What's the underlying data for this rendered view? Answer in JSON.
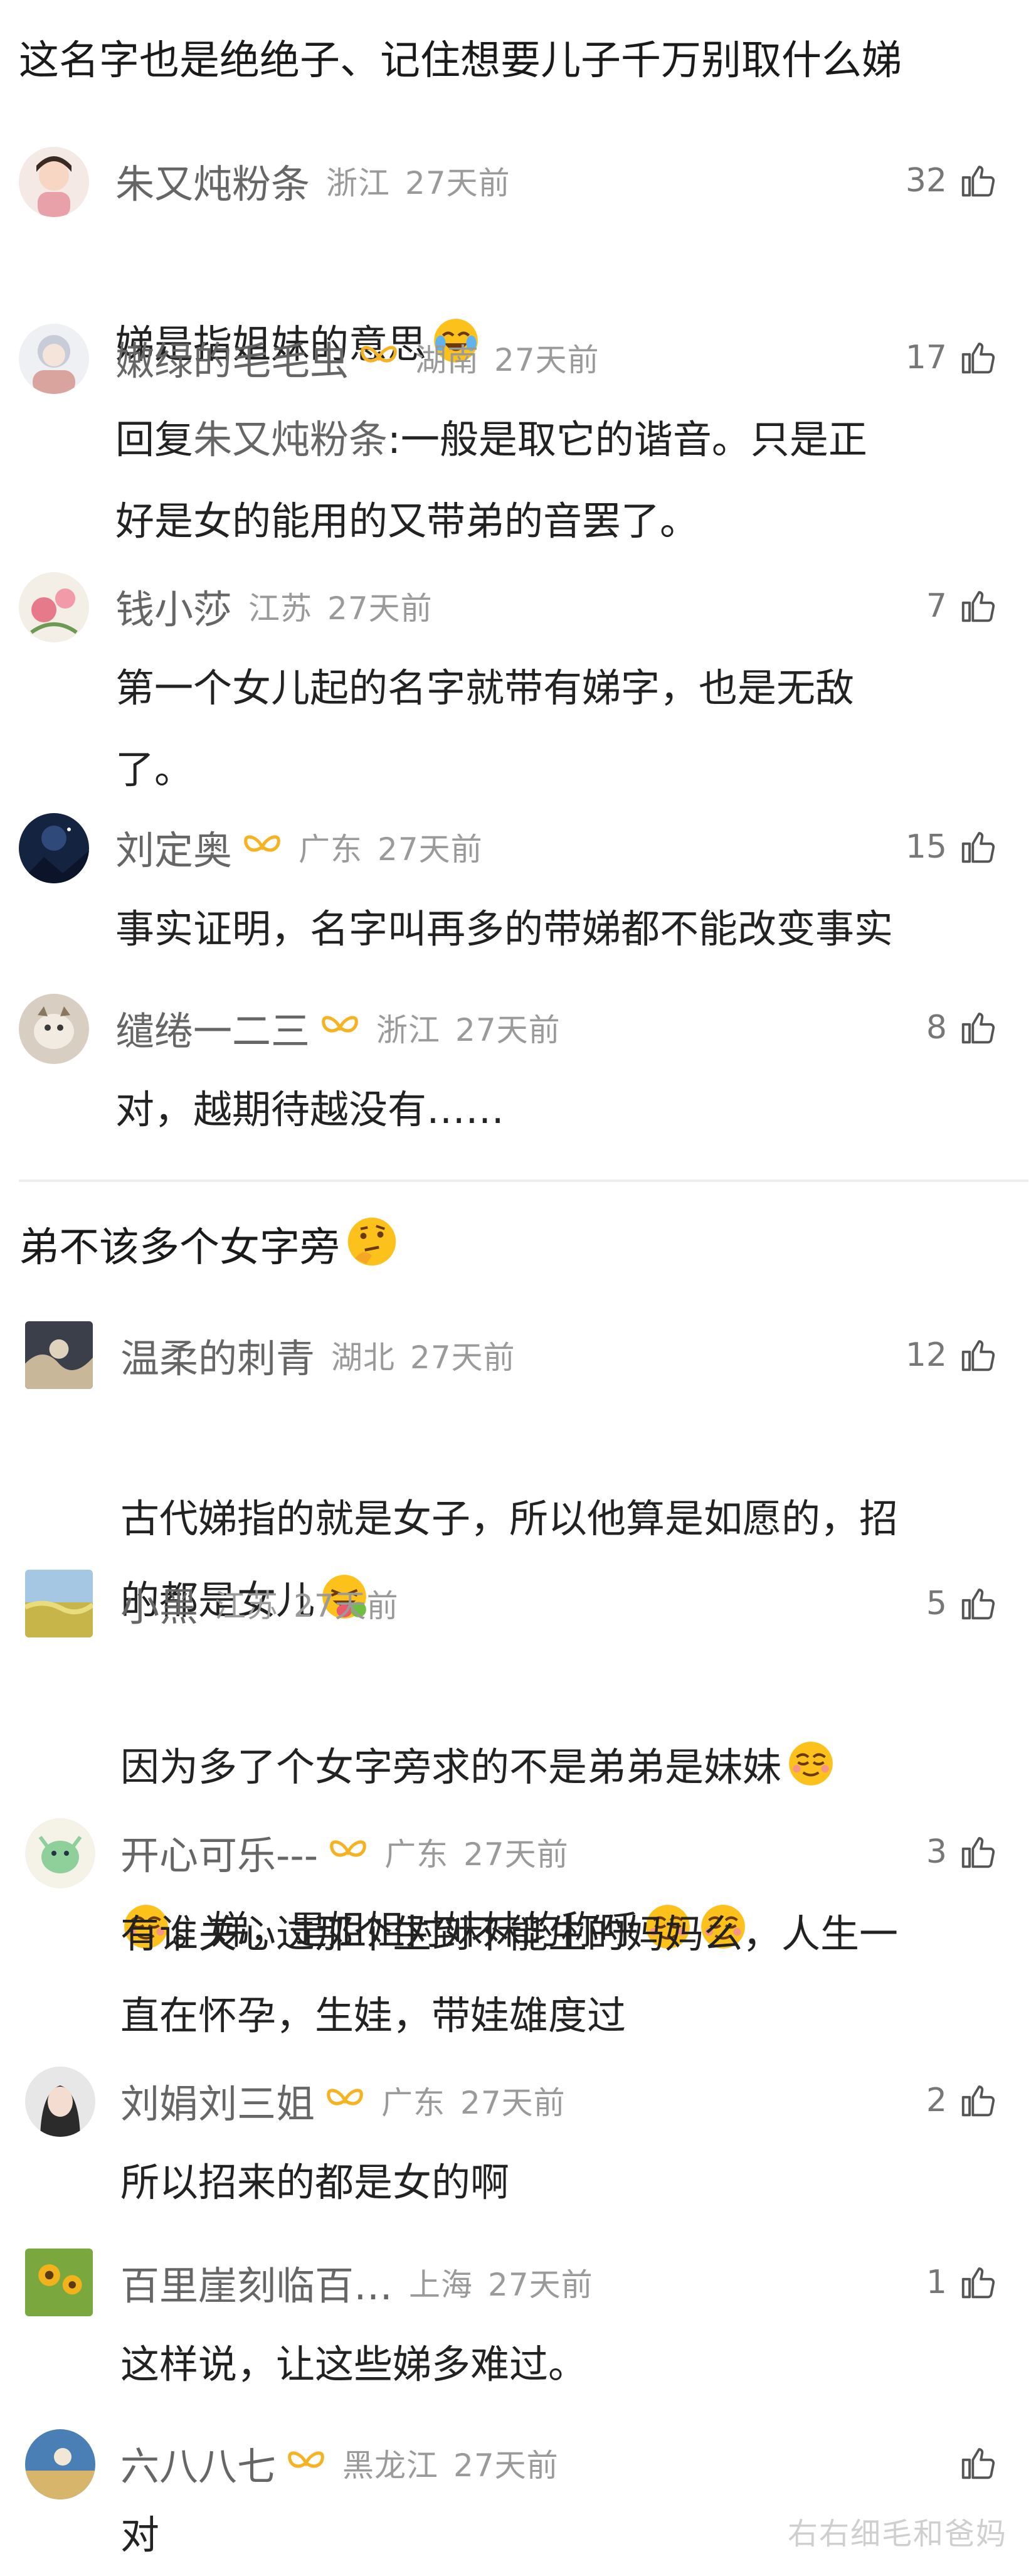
{
  "thread1": {
    "title": "这名字也是绝绝子、记住想要儿子千万别取什么娣",
    "replies": [
      {
        "username": "朱又炖粉条",
        "vip": false,
        "location": "浙江",
        "time": "27天前",
        "likes": "32",
        "text": "娣是指姐妹的意思",
        "emoji": "crying-laughing-emoji"
      },
      {
        "username": "嫩绿的毛毛虫",
        "vip": true,
        "location": "湖南",
        "time": "27天前",
        "likes": "17",
        "text_prefix": "回复",
        "reply_to": "朱又炖粉条",
        "text": ":一般是取它的谐音。只是正\n好是女的能用的又带弟的音罢了。"
      },
      {
        "username": "钱小莎",
        "vip": false,
        "location": "江苏",
        "time": "27天前",
        "likes": "7",
        "text": "第一个女儿起的名字就带有娣字，也是无敌\n了。"
      },
      {
        "username": "刘定奥",
        "vip": true,
        "location": "广东",
        "time": "27天前",
        "likes": "15",
        "text": "事实证明，名字叫再多的带娣都不能改变事实"
      },
      {
        "username": "缱绻一二三",
        "vip": true,
        "location": "浙江",
        "time": "27天前",
        "likes": "8",
        "text": "对，越期待越没有……"
      }
    ]
  },
  "thread2": {
    "title": "弟不该多个女字旁",
    "title_emoji": "thinking-face-emoji",
    "replies": [
      {
        "username": "温柔的刺青",
        "vip": false,
        "location": "湖北",
        "time": "27天前",
        "likes": "12",
        "text": "古代娣指的就是女子，所以他算是如愿的，招\n的都是女儿",
        "emoji": "grinning-with-tongue-emoji"
      },
      {
        "username": "小黑",
        "vip": false,
        "location": "江苏",
        "time": "27天前",
        "likes": "5",
        "line1": "因为多了个女字旁求的不是弟弟是妹妹",
        "line2": "。娣，是姐姐对妹妹的称呼"
      },
      {
        "username": "开心可乐---",
        "vip": true,
        "location": "广东",
        "time": "27天前",
        "likes": "3",
        "text": "有谁关心过那个生到不能生的妈妈么，人生一\n直在怀孕，生娃，带娃雄度过"
      },
      {
        "username": "刘娟刘三姐",
        "vip": true,
        "location": "广东",
        "time": "27天前",
        "likes": "2",
        "text": "所以招来的都是女的啊"
      },
      {
        "username": "百里崖刻临百…",
        "vip": false,
        "location": "上海",
        "time": "27天前",
        "likes": "1",
        "text": "这样说，让这些娣多难过。"
      },
      {
        "username": "六八八七",
        "vip": true,
        "location": "黑龙江",
        "time": "27天前",
        "likes": "",
        "text": "对"
      }
    ]
  },
  "watermark": "右右细毛和爸妈",
  "colors": {
    "username": "#666666",
    "meta": "#9a9a9a",
    "text": "#222222",
    "badge": "#f5b323",
    "divider": "#eeeeee"
  }
}
